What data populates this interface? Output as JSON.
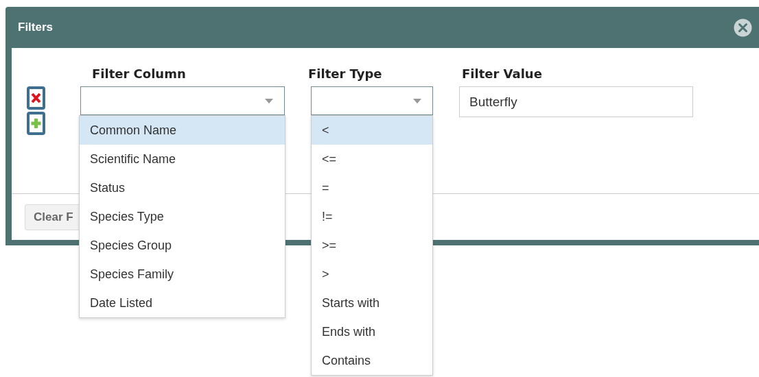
{
  "dialog": {
    "title": "Filters"
  },
  "fields": [
    {
      "kind": "select",
      "heading": "Filter Column",
      "open": true,
      "options": [
        {
          "label": "Common Name",
          "selected": true
        },
        {
          "label": "Scientific Name",
          "selected": false
        },
        {
          "label": "Status",
          "selected": false
        },
        {
          "label": "Species Type",
          "selected": false
        },
        {
          "label": "Species Group",
          "selected": false
        },
        {
          "label": "Species Family",
          "selected": false
        },
        {
          "label": "Date Listed",
          "selected": false
        }
      ]
    },
    {
      "kind": "select",
      "heading": "Filter Type",
      "open": true,
      "options": [
        {
          "label": "<",
          "selected": true
        },
        {
          "label": "<=",
          "selected": false
        },
        {
          "label": "=",
          "selected": false
        },
        {
          "label": "!=",
          "selected": false
        },
        {
          "label": ">=",
          "selected": false
        },
        {
          "label": ">",
          "selected": false
        },
        {
          "label": "Starts with",
          "selected": false
        },
        {
          "label": "Ends with",
          "selected": false
        },
        {
          "label": "Contains",
          "selected": false
        }
      ]
    },
    {
      "kind": "text",
      "heading": "Filter Value",
      "value": "Butterfly"
    }
  ],
  "footer": {
    "buttons": [
      "Clear F"
    ]
  }
}
